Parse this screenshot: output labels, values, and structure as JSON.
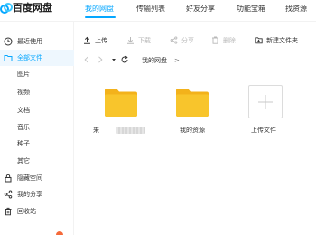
{
  "app": {
    "name": "百度网盘"
  },
  "nav": {
    "tabs": [
      {
        "label": "我的网盘",
        "active": true
      },
      {
        "label": "传输列表",
        "active": false
      },
      {
        "label": "好友分享",
        "active": false
      },
      {
        "label": "功能宝箱",
        "active": false
      },
      {
        "label": "找资源",
        "active": false
      }
    ]
  },
  "sidebar": {
    "items": [
      {
        "label": "最近使用",
        "icon": "clock-icon",
        "active": false
      },
      {
        "label": "全部文件",
        "icon": "folder-icon",
        "active": true
      },
      {
        "label": "图片",
        "icon": "",
        "active": false
      },
      {
        "label": "视频",
        "icon": "",
        "active": false
      },
      {
        "label": "文档",
        "icon": "",
        "active": false
      },
      {
        "label": "音乐",
        "icon": "",
        "active": false
      },
      {
        "label": "种子",
        "icon": "",
        "active": false
      },
      {
        "label": "其它",
        "icon": "",
        "active": false
      },
      {
        "label": "隐藏空间",
        "icon": "lock-icon",
        "active": false
      },
      {
        "label": "我的分享",
        "icon": "share-icon",
        "active": false
      },
      {
        "label": "回收站",
        "icon": "trash-icon",
        "active": false
      }
    ]
  },
  "toolbar": {
    "upload": "上传",
    "download": "下载",
    "share": "分享",
    "delete": "删除",
    "new_folder": "新建文件夹"
  },
  "breadcrumb": {
    "current": "我的网盘",
    "separator": ">"
  },
  "files": [
    {
      "name": "来",
      "type": "folder",
      "name_obscured": true
    },
    {
      "name": "我的资源",
      "type": "folder"
    },
    {
      "name": "上传文件",
      "type": "upload"
    }
  ],
  "colors": {
    "accent": "#06a7ff",
    "folder": "#f8c52c",
    "folder_back": "#f3b21b",
    "disabled_text": "#b8b8b8"
  }
}
